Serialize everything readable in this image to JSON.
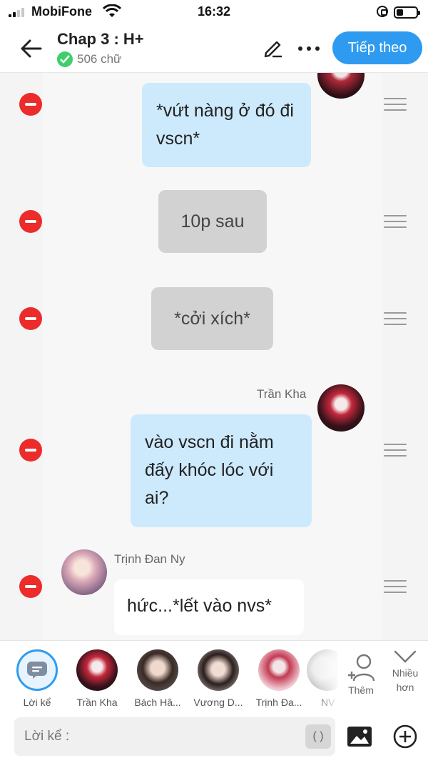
{
  "status_bar": {
    "carrier": "MobiFone",
    "time": "16:32"
  },
  "header": {
    "title": "Chap 3 : H+",
    "word_count": "506 chữ",
    "next_label": "Tiếp theo"
  },
  "messages": [
    {
      "type": "narration-blue",
      "text": "*vứt nàng ở đó đi vscn*"
    },
    {
      "type": "narration-grey",
      "text": "10p sau"
    },
    {
      "type": "narration-grey",
      "text": "*cởi xích*"
    },
    {
      "type": "right",
      "sender": "Trần Kha",
      "text": "vào vscn đi nằm đấy khóc lóc với ai?"
    },
    {
      "type": "left",
      "sender": "Trịnh Đan Ny",
      "text": "hức...*lết vào nvs*"
    }
  ],
  "characters": [
    {
      "label": "Lời kể"
    },
    {
      "label": "Trần Kha"
    },
    {
      "label": "Bách Hâ..."
    },
    {
      "label": "Vương D..."
    },
    {
      "label": "Trịnh Đa..."
    },
    {
      "label": "NV"
    }
  ],
  "add_character_label": "Thêm",
  "collapse_label": "Nhiều hơn",
  "input": {
    "placeholder": "Lời kể :",
    "paren_label": "( )"
  },
  "colors": {
    "accent": "#2f9bf0",
    "bubble_blue": "#cdeafd",
    "bubble_grey": "#d2d2d2",
    "delete_red": "#ec2b2b"
  }
}
